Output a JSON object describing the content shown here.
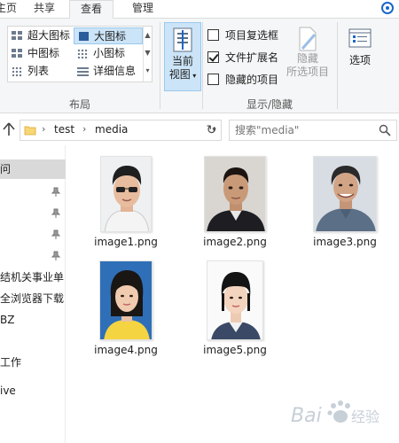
{
  "tabs": [
    {
      "label": "主页",
      "active": false
    },
    {
      "label": "共享",
      "active": false
    },
    {
      "label": "查看",
      "active": true
    },
    {
      "label": "管理",
      "active": false
    }
  ],
  "ribbon": {
    "layout_options": [
      {
        "label": "超大图标",
        "icon": "extra-large-icons-icon",
        "selected": false
      },
      {
        "label": "大图标",
        "icon": "large-icons-icon",
        "selected": true
      },
      {
        "label": "中图标",
        "icon": "medium-icons-icon",
        "selected": false
      },
      {
        "label": "小图标",
        "icon": "small-icons-icon",
        "selected": false
      },
      {
        "label": "列表",
        "icon": "list-icon",
        "selected": false
      },
      {
        "label": "详细信息",
        "icon": "details-icon",
        "selected": false
      }
    ],
    "layout_group_label": "布局",
    "current_view_label_1": "当前",
    "current_view_label_2": "视图",
    "checkboxes": [
      {
        "label": "项目复选框",
        "checked": false
      },
      {
        "label": "文件扩展名",
        "checked": true
      },
      {
        "label": "隐藏的项目",
        "checked": false
      }
    ],
    "hide_selected_1": "隐藏",
    "hide_selected_2": "所选项目",
    "show_hide_group_label": "显示/隐藏",
    "options_label": "选项"
  },
  "address": {
    "crumbs": [
      "test",
      "media"
    ],
    "search_placeholder": "搜索\"media\""
  },
  "nav": {
    "items": [
      {
        "label": "问",
        "selected": true,
        "pinned": false
      },
      {
        "label": "",
        "selected": false,
        "pinned": true
      },
      {
        "label": "",
        "selected": false,
        "pinned": true
      },
      {
        "label": "",
        "selected": false,
        "pinned": true
      },
      {
        "label": "",
        "selected": false,
        "pinned": true
      },
      {
        "label": "结机关事业单",
        "selected": false,
        "pinned": false
      },
      {
        "label": "全浏览器下载",
        "selected": false,
        "pinned": false
      },
      {
        "label": "BZ",
        "selected": false,
        "pinned": false
      },
      {
        "label": "工作",
        "selected": false,
        "pinned": false
      },
      {
        "label": "ive",
        "selected": false,
        "pinned": false
      }
    ]
  },
  "files": [
    {
      "name": "image1.png"
    },
    {
      "name": "image2.png"
    },
    {
      "name": "image3.png"
    },
    {
      "name": "image4.png"
    },
    {
      "name": "image5.png"
    }
  ],
  "colors": {
    "accent": "#1a66c9",
    "selected_bg": "#cce4f7",
    "ribbon_bg": "#f5f6f7"
  }
}
